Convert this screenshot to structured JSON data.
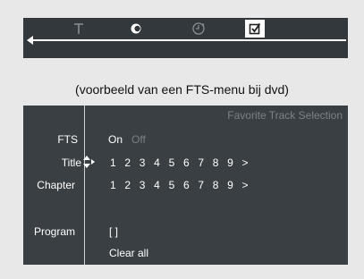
{
  "menu_bar": {
    "icons": [
      {
        "name": "text-t-icon",
        "label": "T"
      },
      {
        "name": "disc-c-icon",
        "label": "C"
      },
      {
        "name": "clock-icon"
      },
      {
        "name": "checkbox-icon"
      }
    ]
  },
  "caption": "(voorbeeld van een FTS-menu bij dvd)",
  "panel": {
    "subtitle": "Favorite Track Selection",
    "rows": {
      "fts_label": "FTS",
      "on": "On",
      "off": "Off",
      "title_label": "Title",
      "chapter_label": "Chapter",
      "program_label": "Program",
      "program_value": "[ ]",
      "clear_all": "Clear all"
    },
    "title_numbers": [
      "1",
      "2",
      "3",
      "4",
      "5",
      "6",
      "7",
      "8",
      "9",
      ">"
    ],
    "chapter_numbers": [
      "1",
      "2",
      "3",
      "4",
      "5",
      "6",
      "7",
      "8",
      "9",
      ">"
    ]
  },
  "colors": {
    "panel_bg": "#3a3f43",
    "menu_bg": "#33383c",
    "text": "#ffffff",
    "dim_text": "#7c8185"
  }
}
